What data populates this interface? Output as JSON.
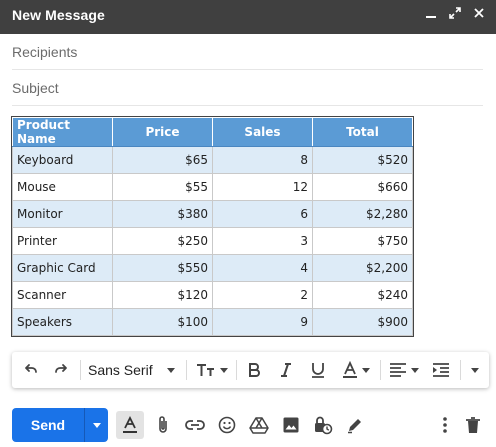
{
  "window": {
    "title": "New Message"
  },
  "fields": {
    "recipients_placeholder": "Recipients",
    "subject_placeholder": "Subject"
  },
  "table": {
    "headers": [
      "Product Name",
      "Price",
      "Sales",
      "Total"
    ],
    "rows": [
      [
        "Keyboard",
        "$65",
        "8",
        "$520"
      ],
      [
        "Mouse",
        "$55",
        "12",
        "$660"
      ],
      [
        "Monitor",
        "$380",
        "6",
        "$2,280"
      ],
      [
        "Printer",
        "$250",
        "3",
        "$750"
      ],
      [
        "Graphic Card",
        "$550",
        "4",
        "$2,200"
      ],
      [
        "Scanner",
        "$120",
        "2",
        "$240"
      ],
      [
        "Speakers",
        "$100",
        "9",
        "$900"
      ]
    ]
  },
  "toolbar": {
    "font_family": "Sans Serif"
  },
  "bottom": {
    "send_label": "Send"
  },
  "colors": {
    "title_bg": "#404040",
    "send_blue": "#1a73e8",
    "table_header": "#5b9bd5",
    "table_band": "#ddebf7"
  }
}
